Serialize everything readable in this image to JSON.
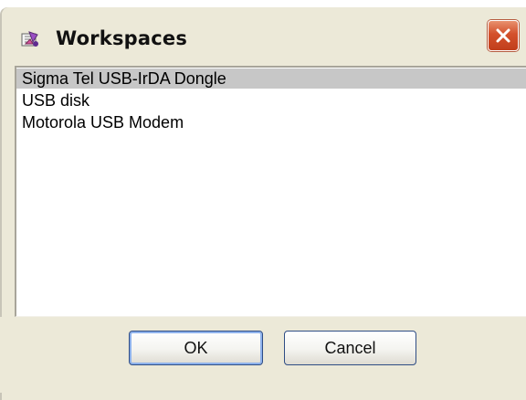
{
  "window": {
    "title": "Workspaces",
    "icon": "workspaces-app-icon",
    "close_icon": "close-icon"
  },
  "list": {
    "items": [
      {
        "label": "Sigma Tel USB-IrDA Dongle",
        "selected": true
      },
      {
        "label": "USB disk",
        "selected": false
      },
      {
        "label": "Motorola USB Modem",
        "selected": false
      }
    ]
  },
  "buttons": {
    "ok_label": "OK",
    "cancel_label": "Cancel"
  },
  "colors": {
    "window_bg": "#ece9d8",
    "selection": "#c7c7c7",
    "close_button": "#d3502b",
    "button_border": "#2f4d85"
  }
}
